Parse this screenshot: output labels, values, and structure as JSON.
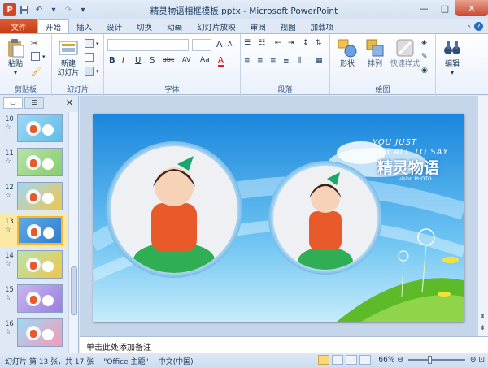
{
  "window": {
    "title": "精灵物语相框模板.pptx - Microsoft PowerPoint",
    "app_logo": "P",
    "controls": {
      "minimize": "—",
      "maximize": "□",
      "close": "✕"
    }
  },
  "qat": {
    "save_icon": "save-icon",
    "undo_icon": "undo-icon",
    "redo_icon": "redo-icon",
    "customize_icon": "customize-icon"
  },
  "ribbon_tabs": {
    "file": "文件",
    "items": [
      "开始",
      "插入",
      "设计",
      "切换",
      "动画",
      "幻灯片放映",
      "审阅",
      "视图",
      "加载项"
    ],
    "active_index": 0
  },
  "ribbon": {
    "clipboard": {
      "label": "剪贴板",
      "paste": "粘贴",
      "cut_icon": "cut-icon",
      "copy_icon": "copy-icon",
      "format_painter_icon": "format-painter-icon"
    },
    "slides": {
      "label": "幻灯片",
      "new_slide_line1": "新建",
      "new_slide_line2": "幻灯片"
    },
    "font": {
      "label": "字体",
      "name_value": "",
      "size_value": "",
      "bold": "B",
      "italic": "I",
      "underline": "U",
      "strike": "S",
      "shadow": "abc",
      "spacing": "AV",
      "case": "Aa",
      "color": "A",
      "grow": "A",
      "shrink": "A"
    },
    "paragraph": {
      "label": "段落"
    },
    "drawing": {
      "label": "绘图",
      "shapes": "形状",
      "arrange": "排列",
      "quick_styles": "快速样式"
    },
    "editing": {
      "label": "",
      "editing_btn": "编辑"
    }
  },
  "slide_pane": {
    "tabs": [
      "",
      ""
    ],
    "close": "✕",
    "thumbnails": [
      {
        "number": "10",
        "mark": "☆"
      },
      {
        "number": "11",
        "mark": "☆"
      },
      {
        "number": "12",
        "mark": "☆"
      },
      {
        "number": "13",
        "mark": "☆"
      },
      {
        "number": "14",
        "mark": "☆"
      },
      {
        "number": "15",
        "mark": "☆"
      },
      {
        "number": "16",
        "mark": "☆"
      }
    ],
    "current_number": "13"
  },
  "slide": {
    "brand_line1": "YOU JUST",
    "brand_line2": "CALL TO SAY",
    "brand_main": "精灵物语",
    "brand_sub": "vision PHOTO"
  },
  "notes": {
    "placeholder": "单击此处添加备注"
  },
  "status": {
    "slide_info": "幻灯片 第 13 张，共 17 张",
    "theme": "\"Office 主题\"",
    "language": "中文(中国)",
    "zoom": "66%",
    "minus": "⊖",
    "plus": "⊕"
  },
  "colors": {
    "sky_top": "#1c7fd8",
    "sky_light": "#8ed2f6",
    "grass": "#5dbb2a",
    "file_tab": "#d24726",
    "current_thumb": "#fde9a6"
  }
}
